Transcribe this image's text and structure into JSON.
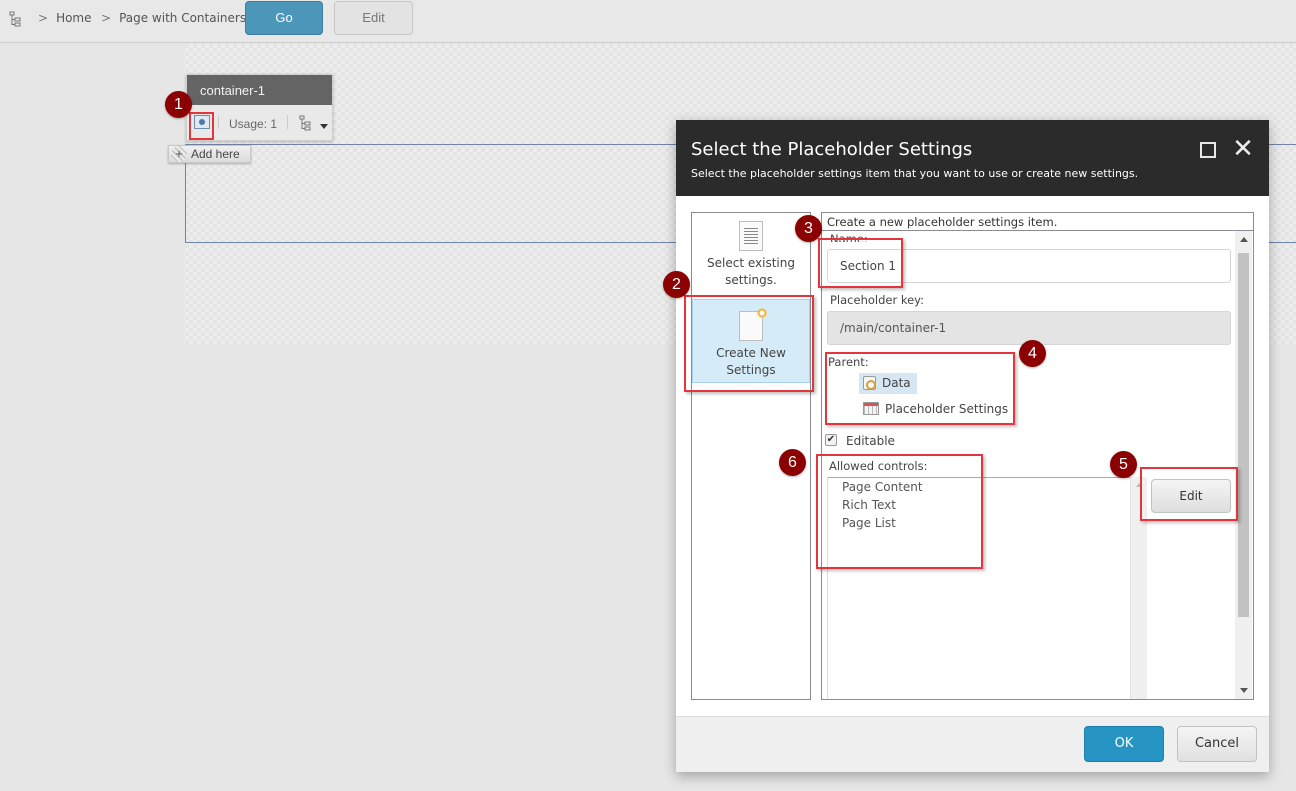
{
  "topbar": {
    "tree_icon": "content-tree-icon",
    "breadcrumb": [
      {
        "label": "Home"
      },
      {
        "label": "Page with Containers"
      }
    ],
    "separator_glyph": ">",
    "go_label": "Go",
    "edit_label": "Edit"
  },
  "container_chrome": {
    "title": "container-1",
    "settings_icon": "placeholder-settings-icon",
    "usage": "Usage: 1",
    "tree_icon": "tree-icon",
    "dropdown_icon": "caret-down-icon"
  },
  "add_here": {
    "plus_glyph": "+",
    "label": "Add here"
  },
  "annotations": [
    "1",
    "2",
    "3",
    "4",
    "5",
    "6"
  ],
  "dialog": {
    "title": "Select the Placeholder Settings",
    "subtitle": "Select the placeholder settings item that you want to use or create new settings.",
    "maximize_icon": "maximize-icon",
    "close_glyph": "✕",
    "options": [
      {
        "label_line1": "Select existing",
        "label_line2": "settings.",
        "icon": "document-icon",
        "selected": false
      },
      {
        "label_line1": "Create New",
        "label_line2": "Settings",
        "icon": "new-document-icon",
        "selected": true
      }
    ],
    "form": {
      "heading": "Create a new placeholder settings item.",
      "name_label": "Name:",
      "name_value": "Section 1",
      "key_label": "Placeholder key:",
      "key_value": "/main/container-1",
      "parent_label": "Parent:",
      "parent_tree": [
        {
          "label": "Data",
          "icon": "data-folder-icon",
          "selected": true
        },
        {
          "label": "Placeholder Settings",
          "icon": "placeholder-settings-folder-icon",
          "selected": false
        }
      ],
      "editable_label": "Editable",
      "editable_checked": true,
      "checkmark_glyph": "✔",
      "allowed_controls_label": "Allowed controls:",
      "allowed_controls": [
        "Page Content",
        "Rich Text",
        "Page List"
      ],
      "edit_controls_label": "Edit"
    },
    "footer": {
      "ok_label": "OK",
      "cancel_label": "Cancel"
    }
  },
  "colors": {
    "accent_blue": "#2795c4",
    "go_button": "#4b96b9",
    "dialog_header": "#2b2b2b",
    "annotation_marker": "#8b0000",
    "highlight_box": "#e3353c",
    "selected_option": "#d5ebf8"
  }
}
